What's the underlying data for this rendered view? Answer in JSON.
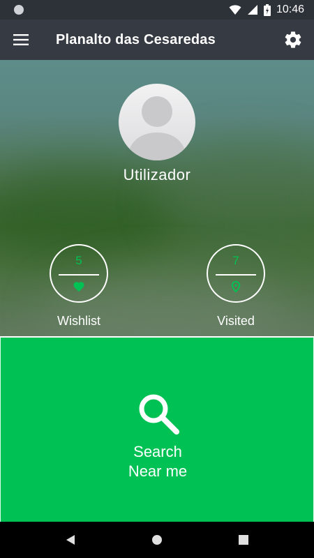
{
  "status_bar": {
    "time": "10:46",
    "icons": [
      "notification-dot-icon",
      "wifi-icon",
      "signal-icon",
      "battery-icon"
    ]
  },
  "app_bar": {
    "title": "Planalto das Cesaredas",
    "menu_icon": "hamburger-menu-icon",
    "settings_icon": "gear-icon"
  },
  "profile": {
    "username": "Utilizador",
    "avatar_icon": "default-avatar-icon"
  },
  "stats": {
    "wishlist": {
      "count": "5",
      "label": "Wishlist",
      "icon": "heart-icon"
    },
    "visited": {
      "count": "7",
      "label": "Visited",
      "icon": "map-pin-icon"
    }
  },
  "search": {
    "line1": "Search",
    "line2": "Near me",
    "icon": "search-icon"
  },
  "nav_bar": {
    "icons": [
      "back-icon",
      "home-icon",
      "recents-icon"
    ]
  },
  "colors": {
    "accent": "#00c254",
    "app_bar": "#363a42",
    "status_bar": "#2d3138"
  }
}
